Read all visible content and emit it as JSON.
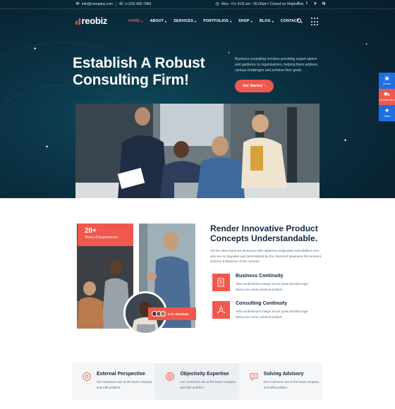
{
  "topbar": {
    "email": "info@company.com",
    "phone": "(+123) 456-7989",
    "hours": "Mon - Fri: 9:00 am - 06.00pm / Closed on Weekends",
    "social": [
      "f",
      "t",
      "p",
      "ig"
    ]
  },
  "nav": {
    "logo": "reobiz",
    "items": [
      {
        "label": "HOME",
        "active": true
      },
      {
        "label": "ABOUT"
      },
      {
        "label": "SERVICES"
      },
      {
        "label": "PORTFOLIOS"
      },
      {
        "label": "SHOP"
      },
      {
        "label": "BLOG"
      },
      {
        "label": "CONTACT"
      }
    ]
  },
  "hero": {
    "title": "Establish A Robust Consulting Firm!",
    "description": "Business consulting involves providing expert advice and guidance to organizations, helping them address various challenges and achieve their goals.",
    "cta": "Get Started"
  },
  "side_widget": {
    "demos": "Demos",
    "purchase": "Purchase Now",
    "ticket": "Ticket"
  },
  "about": {
    "experience_number": "20+",
    "experience_label": "Years of Experiences",
    "reviews": "2 K+ Reviews",
    "title": "Render Innovative Product Concepts Understandable.",
    "description": "On the other hand we denounce with righteous indignation and dislikes men who are so beguiled and demoralized by the charmsof pleasures the moment charms of pleasure of the moment",
    "features": [
      {
        "title": "Business Continuity",
        "text": "Velit condimentum integer lectus quam tincidunt eget Metus nec lorem euismod pretium."
      },
      {
        "title": "Consulting Continuity",
        "text": "Velit condimentum integer lectus quam tincidunt eget Metus nec lorem euismod pretium."
      }
    ]
  },
  "cards": [
    {
      "title": "External Perspective",
      "text": "Our customers are at the heart company and with problem."
    },
    {
      "title": "Objectivity Expertise",
      "text": "Our customers are at the heart company and with problem."
    },
    {
      "title": "Solving Advisory",
      "text": "Our customers are at the heart company and with problem."
    }
  ],
  "colors": {
    "accent": "#f1584d",
    "dark": "#0b3547",
    "heading": "#0f2940",
    "side_blue": "#1f6fe0"
  }
}
